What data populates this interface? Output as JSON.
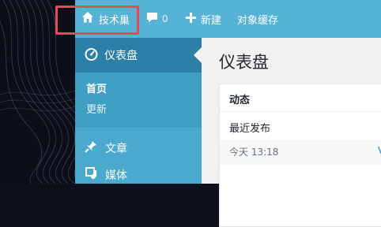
{
  "admin_bar": {
    "site_name": "技术巢",
    "comments_count": "0",
    "new_label": "新建",
    "cache_label": "对象缓存"
  },
  "menu": {
    "current": "仪表盘",
    "submenu": [
      "首页",
      "更新"
    ],
    "items": [
      "文章",
      "媒体"
    ]
  },
  "content": {
    "page_title": "仪表盘",
    "activity_panel": {
      "title": "动态",
      "recent_heading": "最近发布",
      "recent_time": "今天 13:18",
      "recent_link_partial": "V"
    }
  },
  "colors": {
    "admin_bar_bg": "#57b3d6",
    "menu_bg": "#4aa9cc",
    "menu_current_bg": "#2c7fa6",
    "highlight": "#e34a5a"
  }
}
